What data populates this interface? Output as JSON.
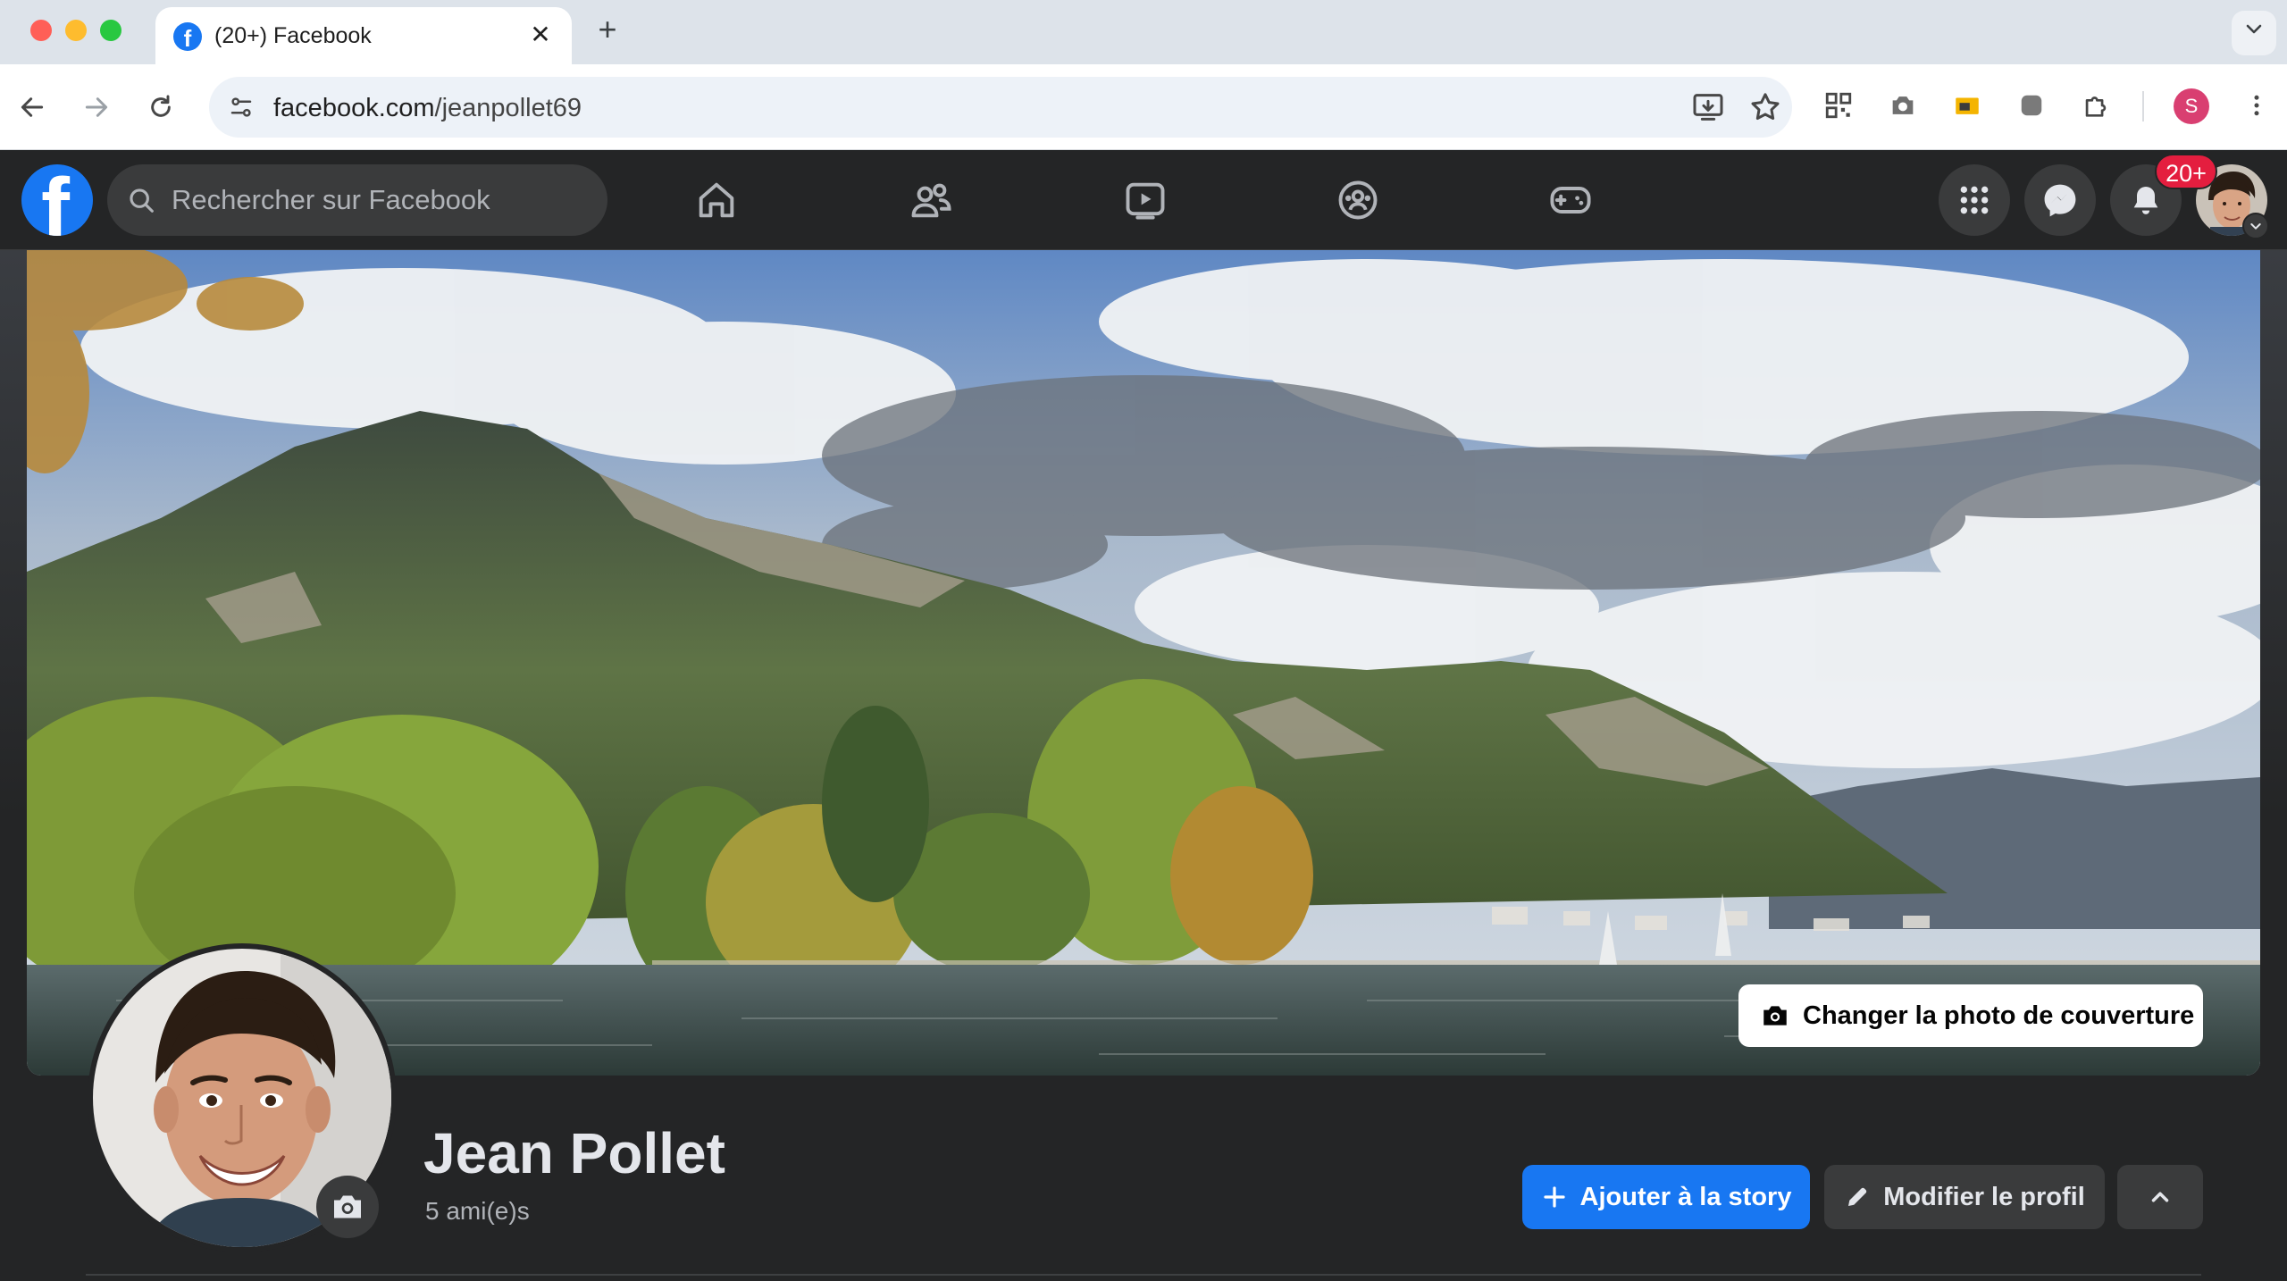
{
  "browser": {
    "tab": {
      "title": "(20+) Facebook",
      "favicon": "facebook-icon",
      "close_label": "✕"
    },
    "new_tab_label": "+",
    "url": {
      "host": "facebook.com",
      "path": "/jeanpollet69"
    },
    "profile_initial": "S",
    "colors": {
      "profile": "#d93f71"
    }
  },
  "facebook": {
    "logo_letter": "f",
    "search": {
      "placeholder": "Rechercher sur Facebook"
    },
    "nav": [
      "home-icon",
      "friends-icon",
      "watch-icon",
      "groups-icon",
      "gaming-icon"
    ],
    "actions": [
      "menu-grid-icon",
      "messenger-icon",
      "notifications-icon"
    ],
    "notifications_badge": "20+",
    "colors": {
      "brand": "#1877f2",
      "badge": "#e41e3f",
      "surface": "#242526"
    }
  },
  "profile": {
    "cover_button": "Changer la photo de couverture",
    "name": "Jean Pollet",
    "friends": "5 ami(e)s",
    "buttons": {
      "add_story": "Ajouter à la story",
      "edit_profile": "Modifier le profil"
    }
  }
}
